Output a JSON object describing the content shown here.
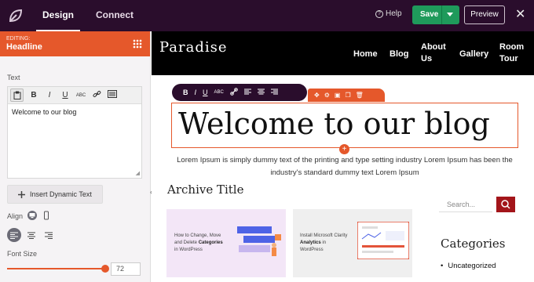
{
  "topbar": {
    "tabs": [
      {
        "label": "Design"
      },
      {
        "label": "Connect"
      }
    ],
    "help_label": "Help",
    "save_label": "Save",
    "preview_label": "Preview",
    "close_glyph": "✕"
  },
  "panel": {
    "editing_label": "EDITING:",
    "editing_block": "Headline",
    "text_label": "Text",
    "editor_value": "Welcome to our blog",
    "dynamic_text_button": "Insert Dynamic Text",
    "align_label": "Align",
    "font_size_label": "Font Size",
    "font_size_value": "72",
    "font_size_fraction": 0.95
  },
  "site": {
    "brand": "Paradise",
    "nav": [
      {
        "label": "Home"
      },
      {
        "label": "Blog"
      },
      {
        "label": "About\nUs"
      },
      {
        "label": "Gallery"
      },
      {
        "label": "Room\nTour"
      }
    ],
    "headline": "Welcome to our blog",
    "paragraph": "Lorem Ipsum is simply dummy text of the printing and type setting industry Lorem Ipsum has been the industry's standard dummy text Lorem Ipsum",
    "archive_title": "Archive Title",
    "cards": [
      {
        "text_pre": "How to Change, Move and Delete ",
        "text_bold": "Categories",
        "text_post": " in WordPress"
      },
      {
        "text_pre": "Install Microsoft Clarity ",
        "text_bold": "Analytics",
        "text_post": " in WordPress"
      }
    ],
    "search_placeholder": "Search...",
    "categories_title": "Categories",
    "categories": [
      "Uncategorized"
    ]
  },
  "colors": {
    "topbar": "#2a0d2c",
    "accent": "#e5582b",
    "save": "#1f9a5b",
    "search_button": "#a3151a"
  },
  "icons": [
    "seedprod-leaf-icon",
    "help-icon",
    "dropdown-caret-icon",
    "close-icon",
    "drag-handle-icon",
    "paste-icon",
    "bold-icon",
    "italic-icon",
    "underline-icon",
    "strikethrough-icon",
    "link-icon",
    "html-icon",
    "desktop-icon",
    "mobile-icon",
    "align-left-icon",
    "align-center-icon",
    "align-right-icon",
    "move-icon",
    "duplicate-icon",
    "delete-icon",
    "add-circle-icon",
    "search-icon"
  ]
}
